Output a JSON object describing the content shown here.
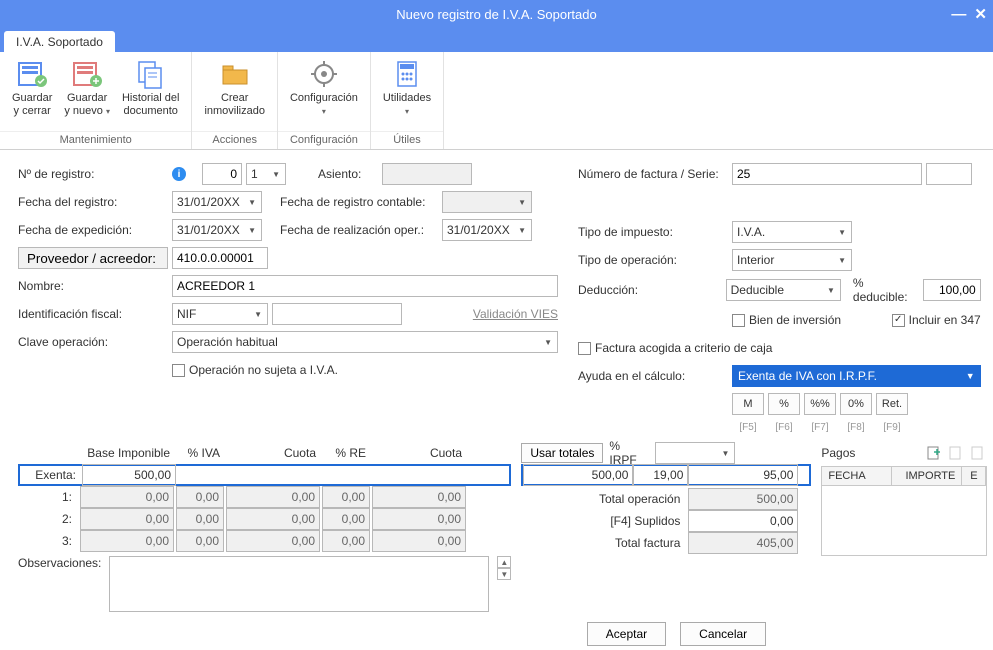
{
  "window": {
    "title": "Nuevo registro de I.V.A. Soportado"
  },
  "tab": {
    "label": "I.V.A. Soportado"
  },
  "ribbon": {
    "groups": [
      {
        "label": "Mantenimiento",
        "items": [
          {
            "t1": "Guardar",
            "t2": "y cerrar"
          },
          {
            "t1": "Guardar",
            "t2": "y nuevo",
            "drop": "▾"
          },
          {
            "t1": "Historial del",
            "t2": "documento"
          }
        ]
      },
      {
        "label": "Acciones",
        "items": [
          {
            "t1": "Crear",
            "t2": "inmovilizado"
          }
        ]
      },
      {
        "label": "Configuración",
        "items": [
          {
            "t1": "Configuración",
            "t2": "",
            "drop": "▾"
          }
        ]
      },
      {
        "label": "Útiles",
        "items": [
          {
            "t1": "Utilidades",
            "t2": "",
            "drop": "▾"
          }
        ]
      }
    ]
  },
  "left": {
    "num_registro_lbl": "Nº de registro:",
    "num_registro_a": "0",
    "num_registro_b": "1",
    "asiento_lbl": "Asiento:",
    "asiento_val": "",
    "fecha_registro_lbl": "Fecha del registro:",
    "fecha_registro_val": "31/01/20XX",
    "fecha_contable_lbl": "Fecha de registro contable:",
    "fecha_contable_val": "",
    "fecha_exp_lbl": "Fecha de expedición:",
    "fecha_exp_val": "31/01/20XX",
    "fecha_oper_lbl": "Fecha de realización oper.:",
    "fecha_oper_val": "31/01/20XX",
    "proveedor_btn": "Proveedor / acreedor:",
    "proveedor_val": "410.0.0.00001",
    "nombre_lbl": "Nombre:",
    "nombre_val": "ACREEDOR 1",
    "id_fiscal_lbl": "Identificación fiscal:",
    "id_fiscal_tipo": "NIF",
    "id_fiscal_val": "",
    "vies": "Validación VIES",
    "clave_lbl": "Clave operación:",
    "clave_val": "Operación habitual",
    "op_no_sujeta": "Operación no sujeta a I.V.A."
  },
  "right": {
    "num_fact_lbl": "Número de factura / Serie:",
    "num_fact_val": "25",
    "serie_val": "",
    "tipo_imp_lbl": "Tipo de impuesto:",
    "tipo_imp_val": "I.V.A.",
    "tipo_op_lbl": "Tipo de operación:",
    "tipo_op_val": "Interior",
    "deduccion_lbl": "Deducción:",
    "deduccion_val": "Deducible",
    "pct_ded_lbl": "% deducible:",
    "pct_ded_val": "100,00",
    "bien_inv": "Bien de inversión",
    "incluir_347": "Incluir en 347",
    "factura_caja": "Factura acogida a criterio de caja",
    "ayuda_lbl": "Ayuda en el cálculo:",
    "ayuda_val": "Exenta de IVA con I.R.P.F.",
    "quick": [
      "M",
      "%",
      "%%",
      "0%",
      "Ret."
    ],
    "fkeys": [
      "[F5]",
      "[F6]",
      "[F7]",
      "[F8]",
      "[F9]"
    ]
  },
  "grid": {
    "hdrs": {
      "base": "Base Imponible",
      "pct_iva": "% IVA",
      "cuota1": "Cuota",
      "pct_re": "% RE",
      "cuota2": "Cuota",
      "usar": "Usar totales",
      "pct_irpf": "% IRPF",
      "pagos": "Pagos"
    },
    "exenta_lbl": "Exenta:",
    "exenta_val": "500,00",
    "rows": [
      {
        "lbl": "1:",
        "base": "0,00",
        "piva": "0,00",
        "c1": "0,00",
        "pre": "0,00",
        "c2": "0,00"
      },
      {
        "lbl": "2:",
        "base": "0,00",
        "piva": "0,00",
        "c1": "0,00",
        "pre": "0,00",
        "c2": "0,00"
      },
      {
        "lbl": "3:",
        "base": "0,00",
        "piva": "0,00",
        "c1": "0,00",
        "pre": "0,00",
        "c2": "0,00"
      }
    ],
    "irpf_base": "500,00",
    "irpf_pct": "19,00",
    "irpf_cuota": "95,00",
    "total_op_lbl": "Total operación",
    "total_op_val": "500,00",
    "suplidos_lbl": "[F4] Suplidos",
    "suplidos_val": "0,00",
    "total_fact_lbl": "Total factura",
    "total_fact_val": "405,00",
    "obs_lbl": "Observaciones:",
    "pago_cols": {
      "fecha": "FECHA",
      "importe": "IMPORTE",
      "e": "E"
    }
  },
  "dlg": {
    "ok": "Aceptar",
    "cancel": "Cancelar"
  }
}
